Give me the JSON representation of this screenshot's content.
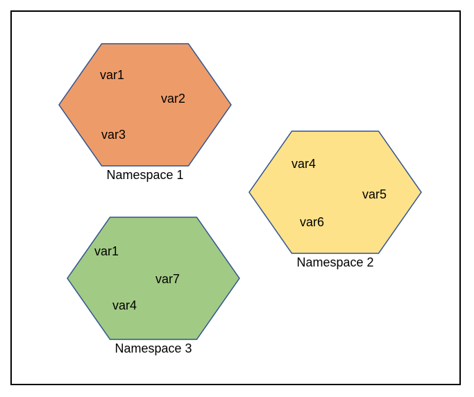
{
  "namespaces": [
    {
      "id": "ns1",
      "label": "Namespace 1",
      "fill": "#ED9C69",
      "stroke": "#2F528F",
      "vars": [
        {
          "id": "ns1-v1",
          "text": "var1"
        },
        {
          "id": "ns1-v2",
          "text": "var2"
        },
        {
          "id": "ns1-v3",
          "text": "var3"
        }
      ]
    },
    {
      "id": "ns2",
      "label": "Namespace 2",
      "fill": "#FDE28A",
      "stroke": "#2F528F",
      "vars": [
        {
          "id": "ns2-v1",
          "text": "var4"
        },
        {
          "id": "ns2-v2",
          "text": "var5"
        },
        {
          "id": "ns2-v3",
          "text": "var6"
        }
      ]
    },
    {
      "id": "ns3",
      "label": "Namespace 3",
      "fill": "#A1CA84",
      "stroke": "#2F528F",
      "vars": [
        {
          "id": "ns3-v1",
          "text": "var1"
        },
        {
          "id": "ns3-v2",
          "text": "var7"
        },
        {
          "id": "ns3-v3",
          "text": "var4"
        }
      ]
    }
  ]
}
